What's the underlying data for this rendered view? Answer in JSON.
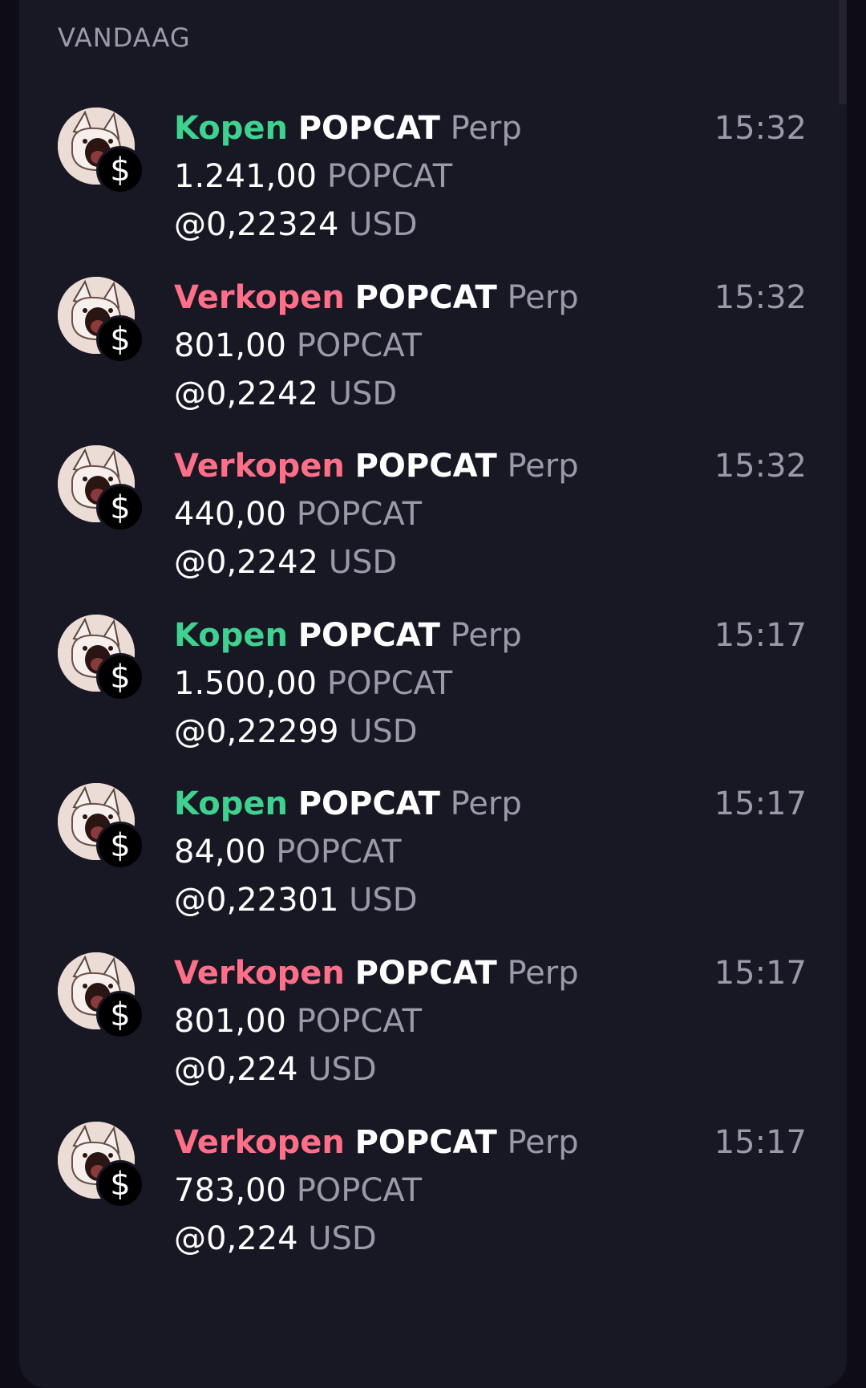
{
  "section": {
    "label": "VANDAAG"
  },
  "trades": [
    {
      "side": "Kopen",
      "kind": "buy",
      "symbol": "POPCAT",
      "market": "Perp",
      "amount": "1.241,00",
      "amount_unit": "POPCAT",
      "at": "@",
      "price": "0,22324",
      "price_unit": "USD",
      "time": "15:32"
    },
    {
      "side": "Verkopen",
      "kind": "sell",
      "symbol": "POPCAT",
      "market": "Perp",
      "amount": "801,00",
      "amount_unit": "POPCAT",
      "at": "@",
      "price": "0,2242",
      "price_unit": "USD",
      "time": "15:32"
    },
    {
      "side": "Verkopen",
      "kind": "sell",
      "symbol": "POPCAT",
      "market": "Perp",
      "amount": "440,00",
      "amount_unit": "POPCAT",
      "at": "@",
      "price": "0,2242",
      "price_unit": "USD",
      "time": "15:32"
    },
    {
      "side": "Kopen",
      "kind": "buy",
      "symbol": "POPCAT",
      "market": "Perp",
      "amount": "1.500,00",
      "amount_unit": "POPCAT",
      "at": "@",
      "price": "0,22299",
      "price_unit": "USD",
      "time": "15:17"
    },
    {
      "side": "Kopen",
      "kind": "buy",
      "symbol": "POPCAT",
      "market": "Perp",
      "amount": "84,00",
      "amount_unit": "POPCAT",
      "at": "@",
      "price": "0,22301",
      "price_unit": "USD",
      "time": "15:17"
    },
    {
      "side": "Verkopen",
      "kind": "sell",
      "symbol": "POPCAT",
      "market": "Perp",
      "amount": "801,00",
      "amount_unit": "POPCAT",
      "at": "@",
      "price": "0,224",
      "price_unit": "USD",
      "time": "15:17"
    },
    {
      "side": "Verkopen",
      "kind": "sell",
      "symbol": "POPCAT",
      "market": "Perp",
      "amount": "783,00",
      "amount_unit": "POPCAT",
      "at": "@",
      "price": "0,224",
      "price_unit": "USD",
      "time": "15:17"
    }
  ],
  "icons": {
    "token": "popcat-cat-icon",
    "badge": "dollar-badge-icon",
    "badge_glyph": "$"
  },
  "colors": {
    "buy": "#3fd28f",
    "sell": "#ff6f87",
    "muted": "#9b9aa8",
    "panel": "#181724",
    "background": "#0e0d17"
  }
}
